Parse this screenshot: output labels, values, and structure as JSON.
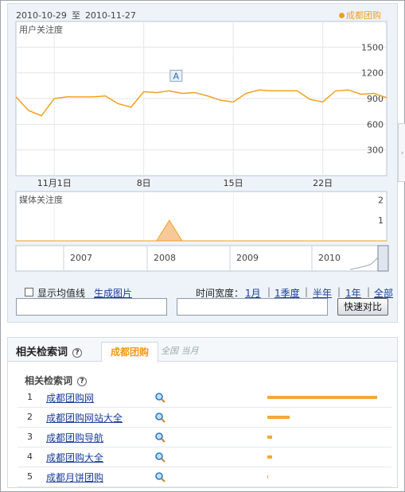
{
  "trend": {
    "date_start": "2010-10-29",
    "date_to": "至",
    "date_end": "2010-11-27",
    "legend_label": "成都团购",
    "series_color": "#f0a020",
    "marker_letter": "A",
    "chart_data": [
      {
        "type": "line",
        "title": "",
        "ylabel": "用户关注度",
        "x": [
          "2010-10-29",
          "2010-10-30",
          "2010-10-31",
          "2010-11-01",
          "2010-11-02",
          "2010-11-03",
          "2010-11-04",
          "2010-11-05",
          "2010-11-06",
          "2010-11-07",
          "2010-11-08",
          "2010-11-09",
          "2010-11-10",
          "2010-11-11",
          "2010-11-12",
          "2010-11-13",
          "2010-11-14",
          "2010-11-15",
          "2010-11-16",
          "2010-11-17",
          "2010-11-18",
          "2010-11-19",
          "2010-11-20",
          "2010-11-21",
          "2010-11-22",
          "2010-11-23",
          "2010-11-24",
          "2010-11-25",
          "2010-11-26",
          "2010-11-27"
        ],
        "xticks": [
          "11月1日",
          "8日",
          "15日",
          "22日"
        ],
        "yticks": [
          300,
          600,
          900,
          1200,
          1500
        ],
        "ylim": [
          0,
          1800
        ],
        "series": [
          {
            "name": "成都团购",
            "values": [
              920,
              760,
              700,
              900,
              920,
              920,
              920,
              930,
              840,
              800,
              980,
              970,
              990,
              960,
              970,
              930,
              880,
              860,
              960,
              1000,
              990,
              990,
              990,
              890,
              860,
              990,
              1000,
              950,
              960,
              910
            ]
          }
        ],
        "annotations": [
          {
            "x": "2010-11-10",
            "label": "A"
          }
        ]
      },
      {
        "type": "area",
        "title": "",
        "ylabel": "媒体关注度",
        "yticks": [
          1,
          2
        ],
        "ylim": [
          0,
          2.4
        ],
        "series": [
          {
            "name": "成都团购",
            "values": [
              0,
              0,
              0,
              0,
              0,
              0,
              0,
              0,
              0,
              0,
              0,
              0,
              1,
              0,
              0,
              0,
              0,
              0,
              0,
              0,
              0,
              0,
              0,
              0,
              0,
              0,
              0,
              0,
              0,
              0
            ]
          }
        ]
      }
    ],
    "overview_years": [
      "2007",
      "2008",
      "2009",
      "2010"
    ]
  },
  "controls": {
    "show_avg_label": "显示均值线",
    "generate_image": "生成图片",
    "time_width_label": "时间宽度：",
    "time_options": [
      "1月",
      "1季度",
      "半年",
      "1年",
      "全部"
    ],
    "compare_button": "快速对比"
  },
  "related": {
    "title": "相关检索词",
    "help": "?",
    "tab_active": "成都团购",
    "tab_inactive": "全国 当月",
    "sub_title": "相关检索词",
    "items": [
      {
        "rank": "1",
        "keyword": "成都团购网",
        "score": 1.0
      },
      {
        "rank": "2",
        "keyword": "成都团购网站大全",
        "score": 0.2
      },
      {
        "rank": "3",
        "keyword": "成都团购导航",
        "score": 0.045
      },
      {
        "rank": "4",
        "keyword": "成都团购大全",
        "score": 0.045
      },
      {
        "rank": "5",
        "keyword": "成都月饼团购",
        "score": 0.007
      }
    ]
  }
}
